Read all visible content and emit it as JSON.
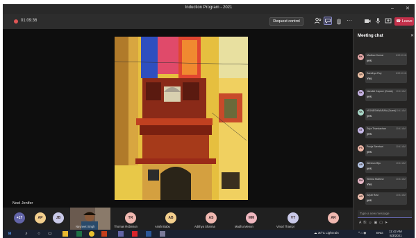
{
  "window": {
    "title": "Induction Program - 2021",
    "min_glyph": "–",
    "close_glyph": "✕"
  },
  "toolbar": {
    "timer": "01:09:36",
    "request_control_label": "Request control",
    "leave_label": "Leave",
    "icons": [
      "people-icon",
      "chat-icon",
      "raise-hand-icon",
      "more-icon",
      "camera-icon",
      "mic-icon",
      "share-icon"
    ],
    "more_glyph": "···",
    "colors": {
      "leave": "#c4314b",
      "recording": "#e05656"
    }
  },
  "stage": {
    "presenter_name": "Noel Jenifer"
  },
  "chat": {
    "title": "Meeting chat",
    "close_glyph": "✕",
    "compose_placeholder": "Type a new message",
    "messages": [
      {
        "initials": "MK",
        "sender": "Madhav Kumar",
        "time": "6/15 10:41",
        "text": "yes",
        "color": "#e8a9a9"
      },
      {
        "initials": "SR",
        "sender": "Sandhya Roy",
        "time": "6/15 10:41",
        "text": "Yes",
        "color": "#f0c4a8"
      },
      {
        "initials": "NK",
        "sender": "Nandini Kapoor (Guest)",
        "time": "10:41 AM",
        "text": "yes",
        "color": "#c9b6e8"
      },
      {
        "initials": "VK",
        "sender": "VIGNESHWARAN (Guest)",
        "time": "10:41 AM",
        "text": "yes",
        "color": "#a8d8c8"
      },
      {
        "initials": "ST",
        "sender": "Suja Thankachan",
        "time": "10:41 AM",
        "text": "yes",
        "color": "#c6b8e8"
      },
      {
        "initials": "PS",
        "sender": "Pooja Sreehari",
        "time": "10:41 AM",
        "text": "yes",
        "color": "#f0b8a8"
      },
      {
        "initials": "AB",
        "sender": "Abhinav Biju",
        "time": "10:41 AM",
        "text": "yes",
        "color": "#b8c8e8"
      },
      {
        "initials": "SM",
        "sender": "Shikha Mathew",
        "time": "10:41 AM",
        "text": "Yes",
        "color": "#e8b8c8"
      },
      {
        "initials": "AR",
        "sender": "Anjali Ravi",
        "time": "10:41 AM",
        "text": "yes",
        "color": "#f0c0b0"
      }
    ]
  },
  "participants": [
    {
      "initials": "+17",
      "name": "",
      "color": "#6264a7"
    },
    {
      "initials": "AP",
      "name": "",
      "color": "#f3cf8d"
    },
    {
      "initials": "JB",
      "name": "",
      "color": "#c9c9e8"
    },
    {
      "initials": "",
      "name": "Navneet Singh",
      "video": true
    },
    {
      "initials": "TR",
      "name": "Thomas Robinson",
      "color": "#f0b8b0"
    },
    {
      "initials": "AB",
      "name": "Arathi Babu",
      "color": "#f3cf8d"
    },
    {
      "initials": "AS",
      "name": "Adithya Sharma",
      "color": "#f0b8b0"
    },
    {
      "initials": "MM",
      "name": "Madhu Menon",
      "color": "#f0b8c0"
    },
    {
      "initials": "VT",
      "name": "Vinod Thampi",
      "color": "#c9c9e8"
    },
    {
      "initials": "AR",
      "name": "",
      "color": "#f0b8b0"
    }
  ],
  "taskbar": {
    "apps": [
      "windows-icon",
      "search-icon",
      "cortana-icon",
      "task-view-icon",
      "file-explorer-icon",
      "excel-icon",
      "chrome-icon",
      "powerpoint-icon",
      "teams-icon",
      "acrobat-icon",
      "word-icon",
      "pen-icon"
    ],
    "start_glyph": "⊞",
    "search_glyph": "⌕",
    "cortana_glyph": "○",
    "taskview_glyph": "▭",
    "weather": "30°C Light rain",
    "tray_glyphs": "^ ⌂ ◉",
    "lang": "ENG",
    "time": "11:42 AM",
    "date": "8/3/2021"
  }
}
